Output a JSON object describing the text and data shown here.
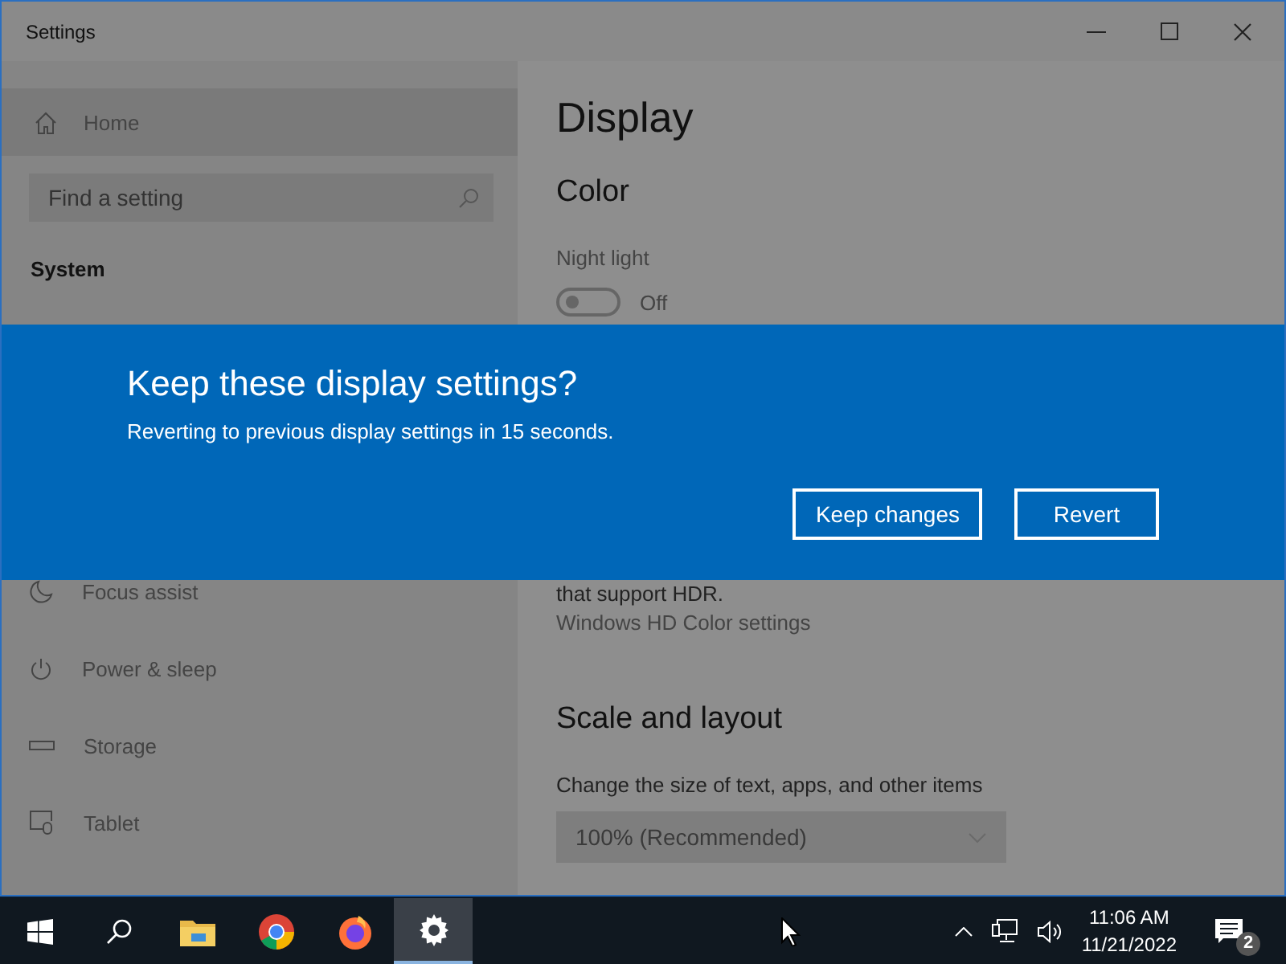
{
  "window": {
    "title": "Settings"
  },
  "sidebar": {
    "home": {
      "label": "Home"
    },
    "search": {
      "placeholder": "Find a setting"
    },
    "section": "System",
    "items": [
      {
        "label": "Focus assist",
        "kind": "moon"
      },
      {
        "label": "Power & sleep",
        "kind": "power"
      },
      {
        "label": "Storage",
        "kind": "storage"
      },
      {
        "label": "Tablet",
        "kind": "tablet"
      }
    ]
  },
  "main": {
    "title": "Display",
    "color_heading": "Color",
    "night_light": {
      "label": "Night light",
      "on": false,
      "state_text": "Off"
    },
    "hdr_text": "that support HDR.",
    "hdr_link": "Windows HD Color settings",
    "scale_heading": "Scale and layout",
    "scale_label": "Change the size of text, apps, and other items",
    "scale_value": "100% (Recommended)"
  },
  "dialog": {
    "title": "Keep these display settings?",
    "message": "Reverting to previous display settings in 15 seconds.",
    "buttons": [
      "Keep changes",
      "Revert"
    ]
  },
  "taskbar": {
    "apps": [
      {
        "kind": "start",
        "selected": false
      },
      {
        "kind": "search",
        "selected": false
      },
      {
        "kind": "explorer",
        "selected": false
      },
      {
        "kind": "chrome",
        "selected": false
      },
      {
        "kind": "firefox",
        "selected": false
      },
      {
        "kind": "settings",
        "selected": true
      }
    ],
    "time": "11:06 AM",
    "date": "11/21/2022",
    "notifications": "2"
  }
}
